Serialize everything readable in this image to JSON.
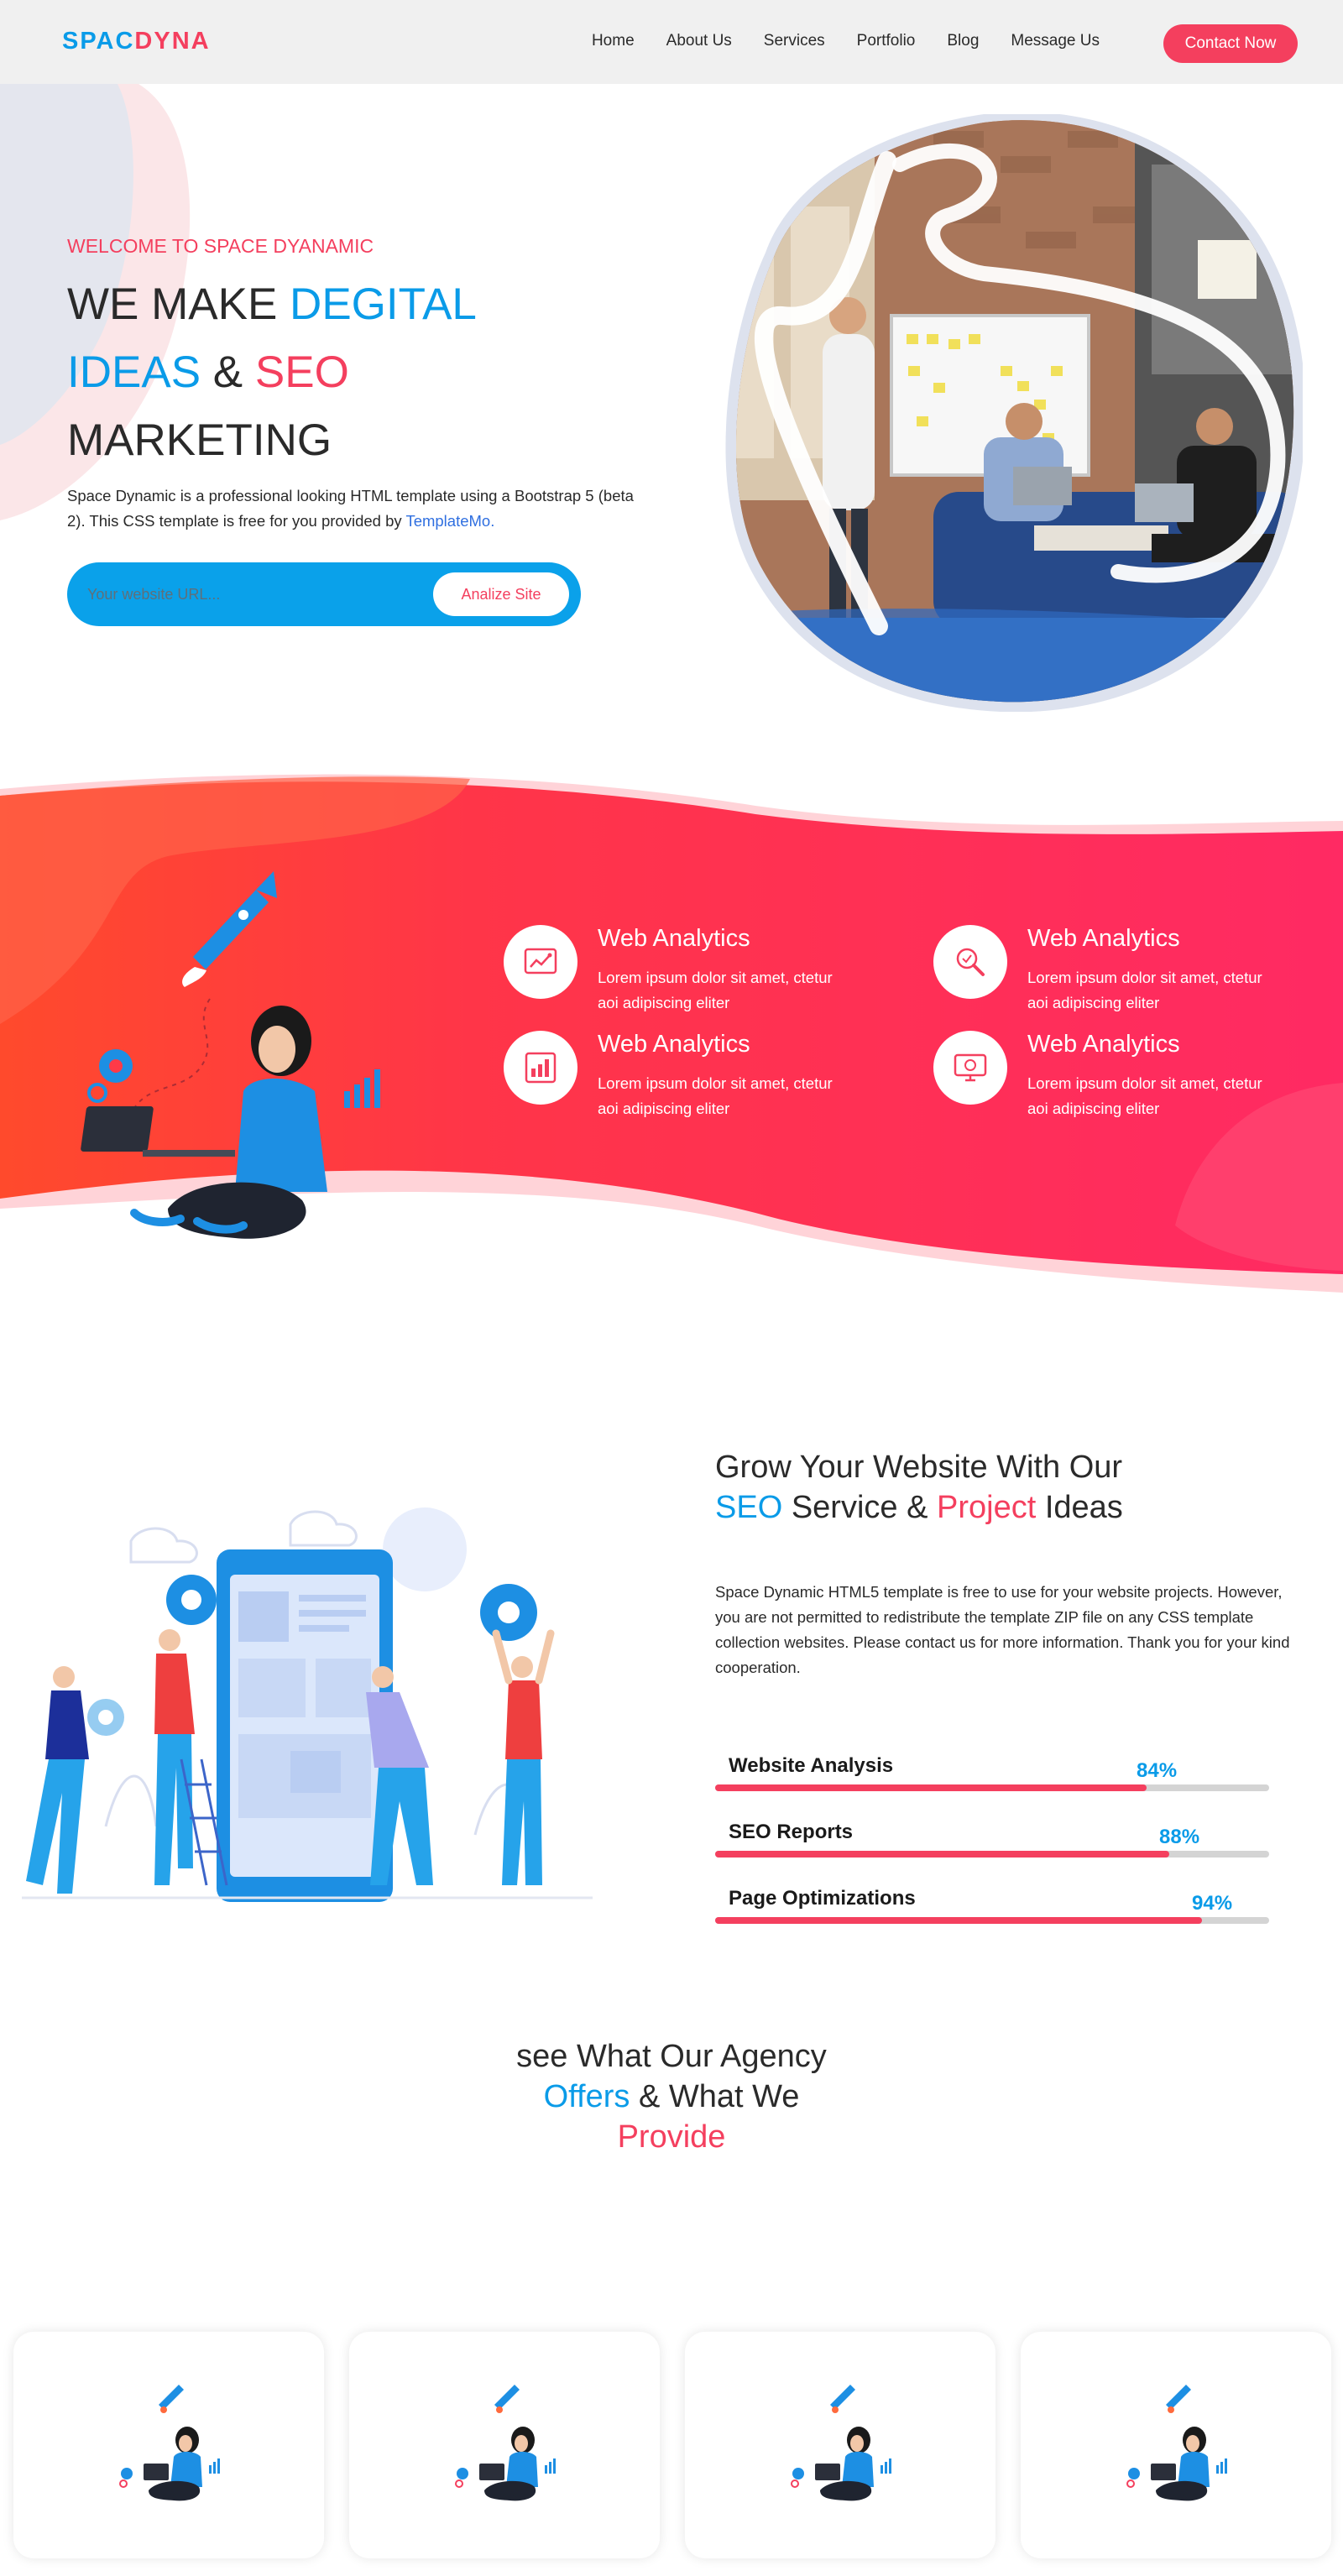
{
  "header": {
    "logo_part1": "SPAC",
    "logo_part2": "DYNA",
    "nav": [
      "Home",
      "About Us",
      "Services",
      "Portfolio",
      "Blog",
      "Message Us"
    ],
    "contact_label": "Contact Now"
  },
  "hero": {
    "kicker": "WELCOME TO SPACE DYANAMIC",
    "title_1": "WE MAKE",
    "title_2": "DEGITAL",
    "title_3": "IDEAS",
    "title_4": "&",
    "title_5": "SEO",
    "title_6": "MARKETING",
    "desc_text": "Space Dynamic is a professional looking HTML template using a Bootstrap 5 (beta 2). This CSS template is free for you provided by",
    "desc_link": "TemplateMo.",
    "url_placeholder": "Your website URL...",
    "analize_label": "Analize Site"
  },
  "features": [
    {
      "title": "Web Analytics",
      "desc": "Lorem ipsum dolor sit amet, ctetur aoi adipiscing eliter",
      "icon": "chart-icon"
    },
    {
      "title": "Web Analytics",
      "desc": "Lorem ipsum dolor sit amet, ctetur aoi adipiscing eliter",
      "icon": "magnifier-icon"
    },
    {
      "title": "Web Analytics",
      "desc": "Lorem ipsum dolor sit amet, ctetur aoi adipiscing eliter",
      "icon": "report-icon"
    },
    {
      "title": "Web Analytics",
      "desc": "Lorem ipsum dolor sit amet, ctetur aoi adipiscing eliter",
      "icon": "monitor-icon"
    }
  ],
  "grow": {
    "title_1": "Grow Your Website With Our",
    "title_2": "SEO",
    "title_3": "Service &",
    "title_4": "Project",
    "title_5": "Ideas",
    "desc": "Space Dynamic HTML5 template is free to use for your website projects. However, you are not permitted to redistribute the template ZIP file on any CSS template collection websites. Please contact us for more information. Thank you for your kind cooperation.",
    "skills": [
      {
        "label": "Website Analysis",
        "percent": 84,
        "percent_text": "84%"
      },
      {
        "label": "SEO Reports",
        "percent": 88,
        "percent_text": "88%"
      },
      {
        "label": "Page Optimizations",
        "percent": 94,
        "percent_text": "94%"
      }
    ]
  },
  "offers": {
    "title_1": "see What Our Agency",
    "title_2": "Offers",
    "title_3": "& What We",
    "title_4": "Provide",
    "card_count": 4
  },
  "colors": {
    "blue": "#0a9be8",
    "red": "#f43f5e",
    "band_start": "#ff4a2c",
    "band_end": "#ff2a63"
  }
}
